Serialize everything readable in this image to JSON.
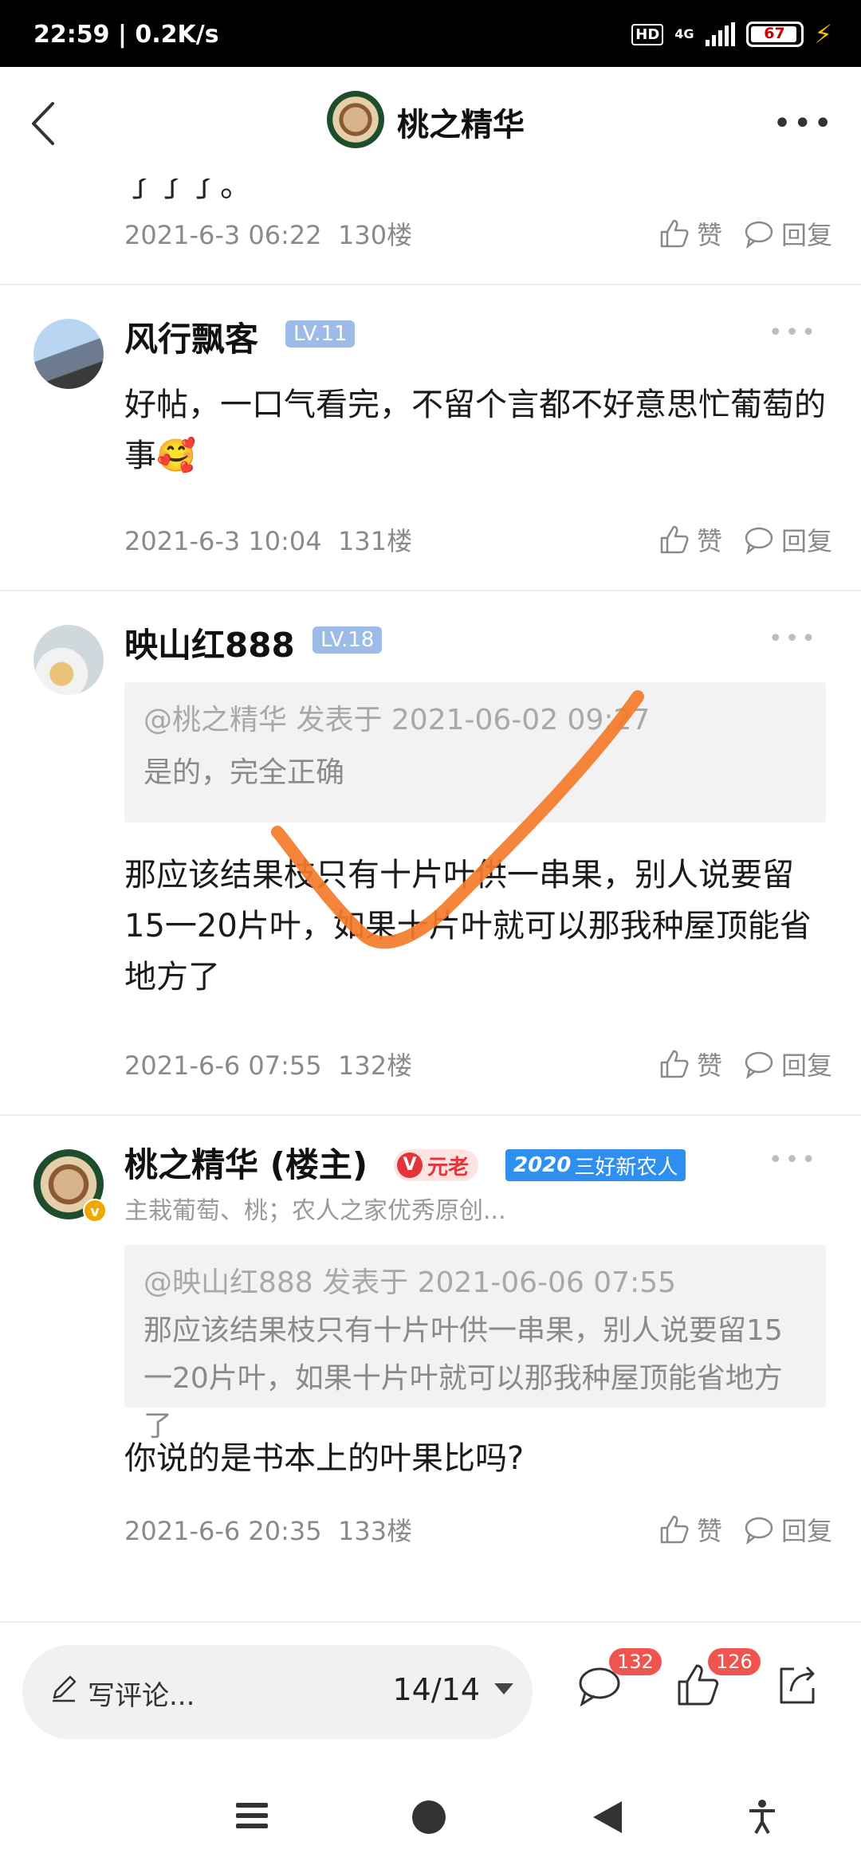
{
  "status_bar": {
    "time": "22:59 | 0.2K/s",
    "hd": "HD",
    "network": "4G",
    "battery": "67"
  },
  "header": {
    "title": "桃之精华"
  },
  "posts": [
    {
      "partial_text": "了了了。",
      "date": "2021-6-3 06:22",
      "floor": "130楼"
    },
    {
      "user": "风行飘客",
      "level": "LV.11",
      "text": "好帖，一口气看完，不留个言都不好意思忙葡萄的事🥰",
      "date": "2021-6-3 10:04",
      "floor": "131楼"
    },
    {
      "user": "映山红888",
      "level": "LV.18",
      "quote_header": "@桃之精华 发表于 2021-06-02 09:27",
      "quote_text": "是的，完全正确",
      "text": "那应该结果枝只有十片叶供一串果，别人说要留15一20片叶，如果十片叶就可以那我种屋顶能省地方了",
      "date": "2021-6-6 07:55",
      "floor": "132楼"
    },
    {
      "user": "桃之精华 (楼主)",
      "badge_old": "元老",
      "badge_old_v": "V",
      "badge_2020_year": "2020",
      "badge_2020_text": "三好新农人",
      "signature": "主栽葡萄、桃；农人之家优秀原创...",
      "quote_header": "@映山红888 发表于 2021-06-06 07:55",
      "quote_text": "那应该结果枝只有十片叶供一串果，别人说要留15一20片叶，如果十片叶就可以那我种屋顶能省地方了",
      "text": "你说的是书本上的叶果比吗?",
      "date": "2021-6-6 20:35",
      "floor": "133楼"
    }
  ],
  "actions": {
    "like": "赞",
    "reply": "回复"
  },
  "bottom_bar": {
    "placeholder": "写评论...",
    "page": "14/14",
    "comment_count": "132",
    "like_count": "126"
  },
  "colors": {
    "accent": "#e5333a",
    "level_badge": "#9cbbe9",
    "annotation": "#f47b2a"
  }
}
